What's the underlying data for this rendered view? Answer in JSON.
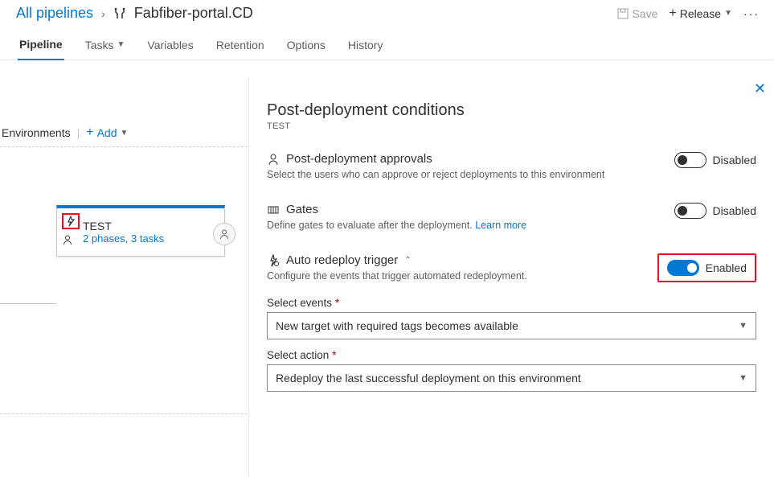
{
  "breadcrumb": {
    "root": "All pipelines",
    "current": "Fabfiber-portal.CD"
  },
  "toolbar": {
    "save": "Save",
    "release": "Release"
  },
  "tabs": {
    "pipeline": "Pipeline",
    "tasks": "Tasks",
    "variables": "Variables",
    "retention": "Retention",
    "options": "Options",
    "history": "History"
  },
  "environments": {
    "header": "Environments",
    "add": "Add",
    "stage": {
      "name": "TEST",
      "subtitle": "2 phases, 3 tasks"
    }
  },
  "panel": {
    "title": "Post-deployment conditions",
    "subtitle": "TEST",
    "approvals": {
      "title": "Post-deployment approvals",
      "desc": "Select the users who can approve or reject deployments to this environment",
      "state": "Disabled"
    },
    "gates": {
      "title": "Gates",
      "desc": "Define gates to evaluate after the deployment. ",
      "learn": "Learn more",
      "state": "Disabled"
    },
    "redeploy": {
      "title": "Auto redeploy trigger",
      "desc": "Configure the events that trigger automated redeployment.",
      "state": "Enabled"
    },
    "events": {
      "label": "Select events",
      "value": "New target with required tags becomes available"
    },
    "action": {
      "label": "Select action",
      "value": "Redeploy the last successful deployment on this environment"
    }
  }
}
